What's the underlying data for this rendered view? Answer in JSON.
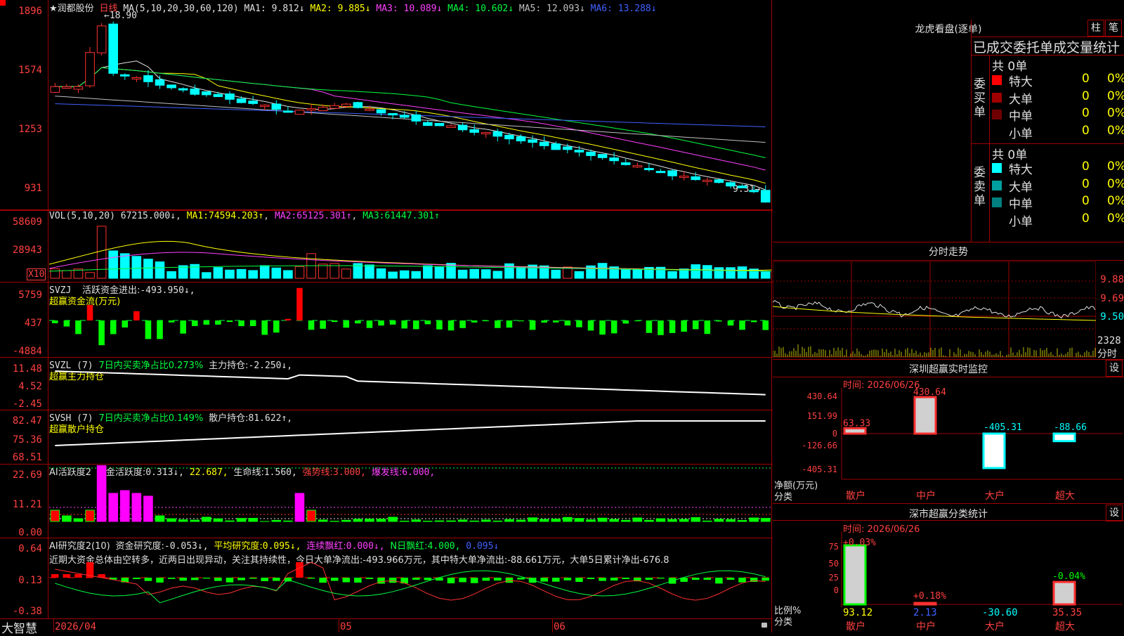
{
  "stock": {
    "name": "★润都股份",
    "period": "日线",
    "ma_header": "MA(5,10,20,30,60,120)",
    "ma": [
      {
        "label": "MA1:",
        "value": "9.812↓",
        "color": "#e0e0e0"
      },
      {
        "label": "MA2:",
        "value": "9.885↓",
        "color": "#ffff00"
      },
      {
        "label": "MA3:",
        "value": "10.089↓",
        "color": "#ff40ff"
      },
      {
        "label": "MA4:",
        "value": "10.602↓",
        "color": "#00ff40"
      },
      {
        "label": "MA5:",
        "value": "12.093↓",
        "color": "#c0c0c0"
      },
      {
        "label": "MA6:",
        "value": "13.288↓",
        "color": "#4060ff"
      }
    ],
    "price_axis": [
      "1896",
      "1574",
      "1253",
      "931"
    ],
    "high_label": "18.90",
    "last_label": "9.31"
  },
  "vol": {
    "header": "VOL(5,10,20)",
    "value": "67215.000↓",
    "ma1_label": "MA1:",
    "ma1": "74594.203↑",
    "ma2_label": "MA2:",
    "ma2": "65125.301↑",
    "ma3_label": "MA3:",
    "ma3": "61447.301↑",
    "axis": [
      "58609",
      "28943"
    ],
    "unit": "X10"
  },
  "svzj": {
    "header": "SVZJ",
    "label": "活跃资金进出:",
    "value": "-493.950↓,",
    "sub": "超赢资金流(万元)",
    "axis": [
      "5759",
      "437",
      "-4884"
    ]
  },
  "svzl": {
    "header": "SVZL (7)",
    "label1": "7日内买卖净占比0.273%",
    "label2": "主力持仓:",
    "value": "-2.250↓,",
    "sub": "超赢主力持仓",
    "axis": [
      "11.48",
      "4.52",
      "-2.45"
    ]
  },
  "svsh": {
    "header": "SVSH (7)",
    "label1": "7日内买卖净占比0.149%",
    "label2": "散户持仓:",
    "value": "81.622↑,",
    "sub": "超赢散户持仓",
    "axis": [
      "82.47",
      "75.36",
      "68.51"
    ]
  },
  "ai1": {
    "header": "AI活跃度2",
    "label": "资金活跃度:",
    "v1": "0.313↓,",
    "v2": "22.687,",
    "label2": "生命线:",
    "v3": "1.560,",
    "label3": "强势线:",
    "v4": "3.000,",
    "label4": "爆发线:",
    "v5": "6.000,",
    "axis": [
      "22.69",
      "11.21",
      "0.00"
    ]
  },
  "ai2": {
    "header": "AI研究度2(10)",
    "label": "资金研究度:",
    "v1": "-0.053↓,",
    "label2": "平均研究度:",
    "v2": "0.095↓,",
    "label3": "连续飘红:",
    "v3": "0.000↓,",
    "label4": "N日飘红:",
    "v4": "4.000,",
    "v5": "0.095↓",
    "note": "近期大资金总体由空转多，近两日出现异动，关注其持续性，今日大单净流出:-493.966万元，其中特大单净流出:-88.661万元，大单5日累计净出-676.8",
    "axis": [
      "0.64",
      "0.13",
      "-0.38"
    ]
  },
  "xaxis": {
    "d1": "2026/04",
    "d2": "05",
    "d3": "06"
  },
  "footer": {
    "brand": "大智慧"
  },
  "longhu": {
    "title": "龙虎看盘(逐单)",
    "btn1": "柱",
    "btn2": "笔",
    "subtitle": "已成交委托单成交量统计",
    "buy_label": "委买单",
    "sell_label": "委卖单",
    "buy_total": "共 0单",
    "sell_total": "共 0单",
    "buy_rows": [
      {
        "name": "特大",
        "count": "0",
        "pct": "0%",
        "color": "#ff0000"
      },
      {
        "name": "大单",
        "count": "0",
        "pct": "0%",
        "color": "#a00000"
      },
      {
        "name": "中单",
        "count": "0",
        "pct": "0%",
        "color": "#700000"
      },
      {
        "name": "小单",
        "count": "0",
        "pct": "0%",
        "color": ""
      }
    ],
    "sell_rows": [
      {
        "name": "特大",
        "count": "0",
        "pct": "0%",
        "color": "#00ffff"
      },
      {
        "name": "大单",
        "count": "0",
        "pct": "0%",
        "color": "#00a0a0"
      },
      {
        "name": "中单",
        "count": "0",
        "pct": "0%",
        "color": "#008080"
      },
      {
        "name": "小单",
        "count": "0",
        "pct": "0%",
        "color": ""
      }
    ]
  },
  "fenshi": {
    "title": "分时走势",
    "axis": [
      "9.88",
      "9.69",
      "9.50"
    ],
    "vol_label": "2328",
    "unit": "分时"
  },
  "monitor": {
    "title": "深圳超赢实时监控",
    "btn": "设",
    "date": "时间: 2026/06/26",
    "axis": [
      "430.64",
      "151.99",
      "0",
      "-126.66",
      "-405.31"
    ],
    "ylabel": "净额(万元)",
    "xlabel": "分类",
    "cats": [
      "散户",
      "中户",
      "大户",
      "超大"
    ],
    "values": [
      63.33,
      430.64,
      -405.31,
      -88.66
    ],
    "value_labels": [
      "63.33",
      "430.64",
      "-405.31",
      "-88.66"
    ]
  },
  "classify": {
    "title": "深市超赢分类统计",
    "btn": "设",
    "date": "时间: 2026/06/26",
    "axis": [
      "75",
      "50",
      "25",
      "0"
    ],
    "ylabel": "比例%",
    "xlabel": "分类",
    "cats": [
      "散户",
      "中户",
      "大户",
      "超大"
    ],
    "top_labels": [
      "+0.03%",
      "+0.18%",
      "",
      "-0.04%"
    ],
    "bottom_labels": [
      "93.12",
      "2.13",
      "-30.60",
      "35.35"
    ],
    "values": [
      93.12,
      2.13,
      -30.6,
      35.35
    ]
  }
}
